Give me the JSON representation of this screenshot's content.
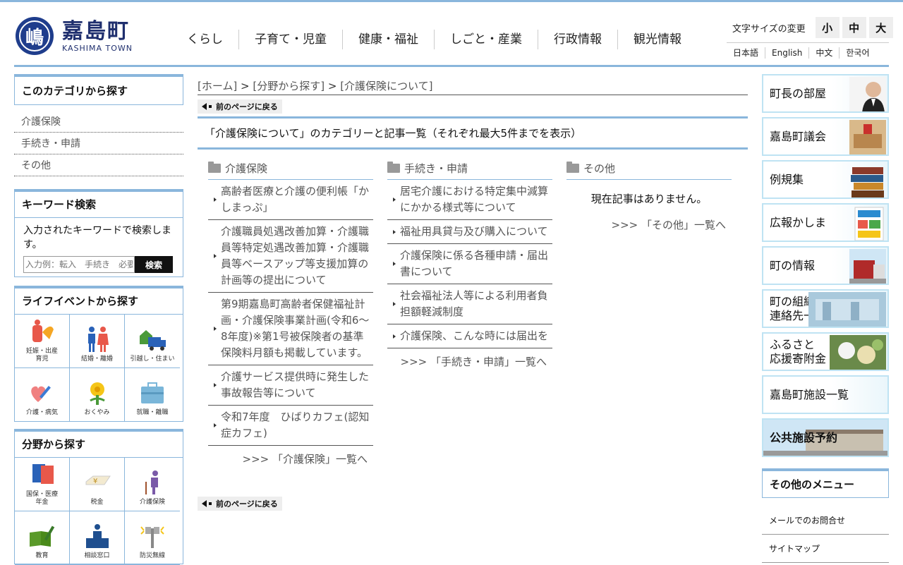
{
  "header": {
    "logo_jp": "嘉島町",
    "logo_en": "KASHIMA TOWN",
    "logo_mark": "嶋",
    "nav": [
      "くらし",
      "子育て・児童",
      "健康・福祉",
      "しごと・産業",
      "行政情報",
      "観光情報"
    ],
    "fontsize_label": "文字サイズの変更",
    "fontsize_buttons": [
      "小",
      "中",
      "大"
    ],
    "languages": [
      "日本語",
      "English",
      "中文",
      "한국어"
    ]
  },
  "left": {
    "category_title": "このカテゴリから探す",
    "categories": [
      "介護保険",
      "手続き・申請",
      "その他"
    ],
    "keyword_title": "キーワード検索",
    "keyword_desc": "入力されたキーワードで検索します。",
    "keyword_placeholder": "入力例：転入　手続き　必要書類",
    "keyword_button": "検索",
    "life_title": "ライフイベントから探す",
    "life_items": [
      "妊娠・出産\n育児",
      "結婚・離婚",
      "引越し・住まい",
      "介護・病気",
      "おくやみ",
      "就職・離職"
    ],
    "bunya_title": "分野から探す",
    "bunya_items": [
      "国保・医療\n年金",
      "税金",
      "介護保険",
      "教育",
      "相談窓口",
      "防災無線"
    ]
  },
  "main": {
    "breadcrumb": {
      "home": "[ホーム]",
      "sep1": " > ",
      "field": "[分野から探す]",
      "sep2": " > ",
      "current": "[介護保険について]"
    },
    "back_label": "前のページに戻る",
    "heading": "「介護保険について」のカテゴリーと記事一覧（それぞれ最大5件までを表示）",
    "columns": [
      {
        "title": "介護保険",
        "items": [
          "高齢者医療と介護の便利帳「かしまっぷ」",
          "介護職員処遇改善加算・介護職員等特定処遇改善加算・介護職員等ベースアップ等支援加算の計画等の提出について",
          "第9期嘉島町高齢者保健福祉計画・介護保険事業計画(令和6～8年度)※第1号被保険者の基準保険料月額も掲載しています。",
          "介護サービス提供時に発生した事故報告等について",
          "令和7年度　ひばりカフェ(認知症カフェ)"
        ],
        "more": ">>> 「介護保険」一覧へ"
      },
      {
        "title": "手続き・申請",
        "items": [
          "居宅介護における特定集中減算にかかる様式等について",
          "福祉用具貸与及び購入について",
          "介護保険に係る各種申請・届出書について",
          "社会福祉法人等による利用者負担額軽減制度",
          "介護保険、こんな時には届出を"
        ],
        "more": ">>> 「手続き・申請」一覧へ"
      },
      {
        "title": "その他",
        "none": "現在記事はありません。",
        "more": ">>> 「その他」一覧へ"
      }
    ]
  },
  "right": {
    "banners": [
      "町長の部屋",
      "嘉島町議会",
      "例規集",
      "広報かしま",
      "町の情報",
      "町の組織\n連絡先一覧",
      "ふるさと\n応援寄附金",
      "嘉島町施設一覧",
      "公共施設予約"
    ],
    "other_title": "その他のメニュー",
    "other_items": [
      "メールでのお問合せ",
      "サイトマップ"
    ]
  }
}
